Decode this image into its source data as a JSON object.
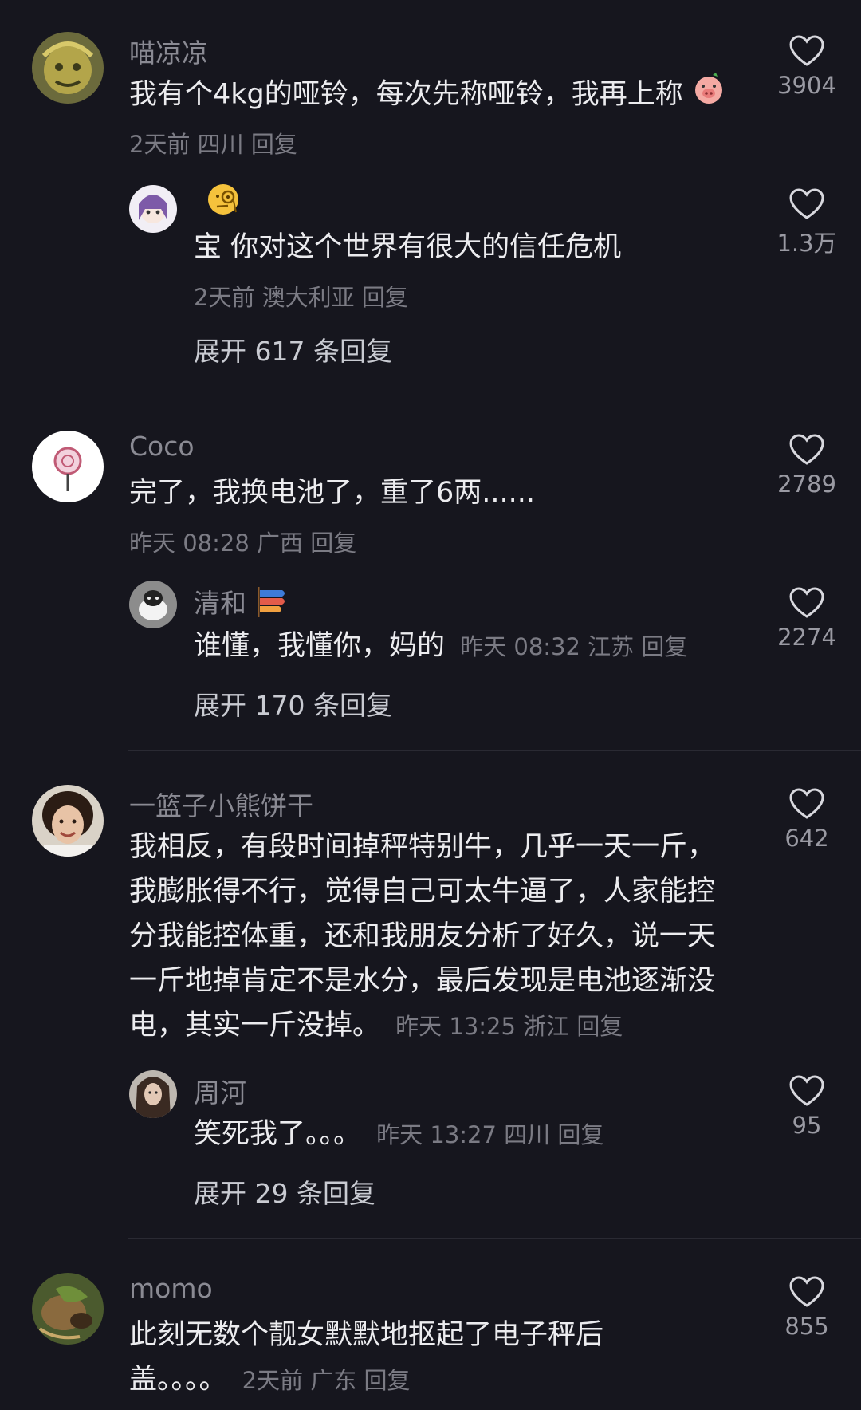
{
  "comments": [
    {
      "username": "喵凉凉",
      "text": "我有个4kg的哑铃，每次先称哑铃，我再上称",
      "meta": "2天前 四川 回复",
      "likes": "3904",
      "reply": {
        "username": "",
        "text": "宝 你对这个世界有很大的信任危机",
        "meta": "2天前 澳大利亚 回复",
        "likes": "1.3万"
      },
      "expand": "展开 617 条回复"
    },
    {
      "username": "Coco",
      "text": "完了，我换电池了，重了6两......",
      "meta": "昨天 08:28 广西 回复",
      "likes": "2789",
      "reply": {
        "username": "清和",
        "text": "谁懂，我懂你，妈的",
        "meta": "昨天 08:32 江苏 回复",
        "likes": "2274"
      },
      "expand": "展开 170 条回复"
    },
    {
      "username": "一篮子小熊饼干",
      "text_lines": [
        "我相反，有段时间掉秤特别牛，几乎一天一斤，",
        "我膨胀得不行，觉得自己可太牛逼了，人家能控",
        "分我能控体重，还和我朋友分析了好久，说一天",
        "一斤地掉肯定不是水分，最后发现是电池逐渐没",
        "电，其实一斤没掉。"
      ],
      "meta": "昨天 13:25 浙江 回复",
      "likes": "642",
      "reply": {
        "username": "周河",
        "text": "笑死我了。。。",
        "meta": "昨天 13:27 四川 回复",
        "likes": "95"
      },
      "expand": "展开 29 条回复"
    },
    {
      "username": "momo",
      "text_lines": [
        "此刻无数个靓女默默地抠起了电子秤后",
        "盖。。。。"
      ],
      "meta": "2天前 广东 回复",
      "likes": "855"
    }
  ],
  "icons": {
    "like": "heart-outline-icon",
    "emoji_pig": "pig-face-emoji",
    "emoji_monocle": "monocle-face-emoji",
    "emoji_flag": "carp-streamer-emoji"
  },
  "colors": {
    "background": "#16161e",
    "text": "#ececef",
    "muted": "#7b7b84",
    "expand": "#c9cbd2"
  }
}
